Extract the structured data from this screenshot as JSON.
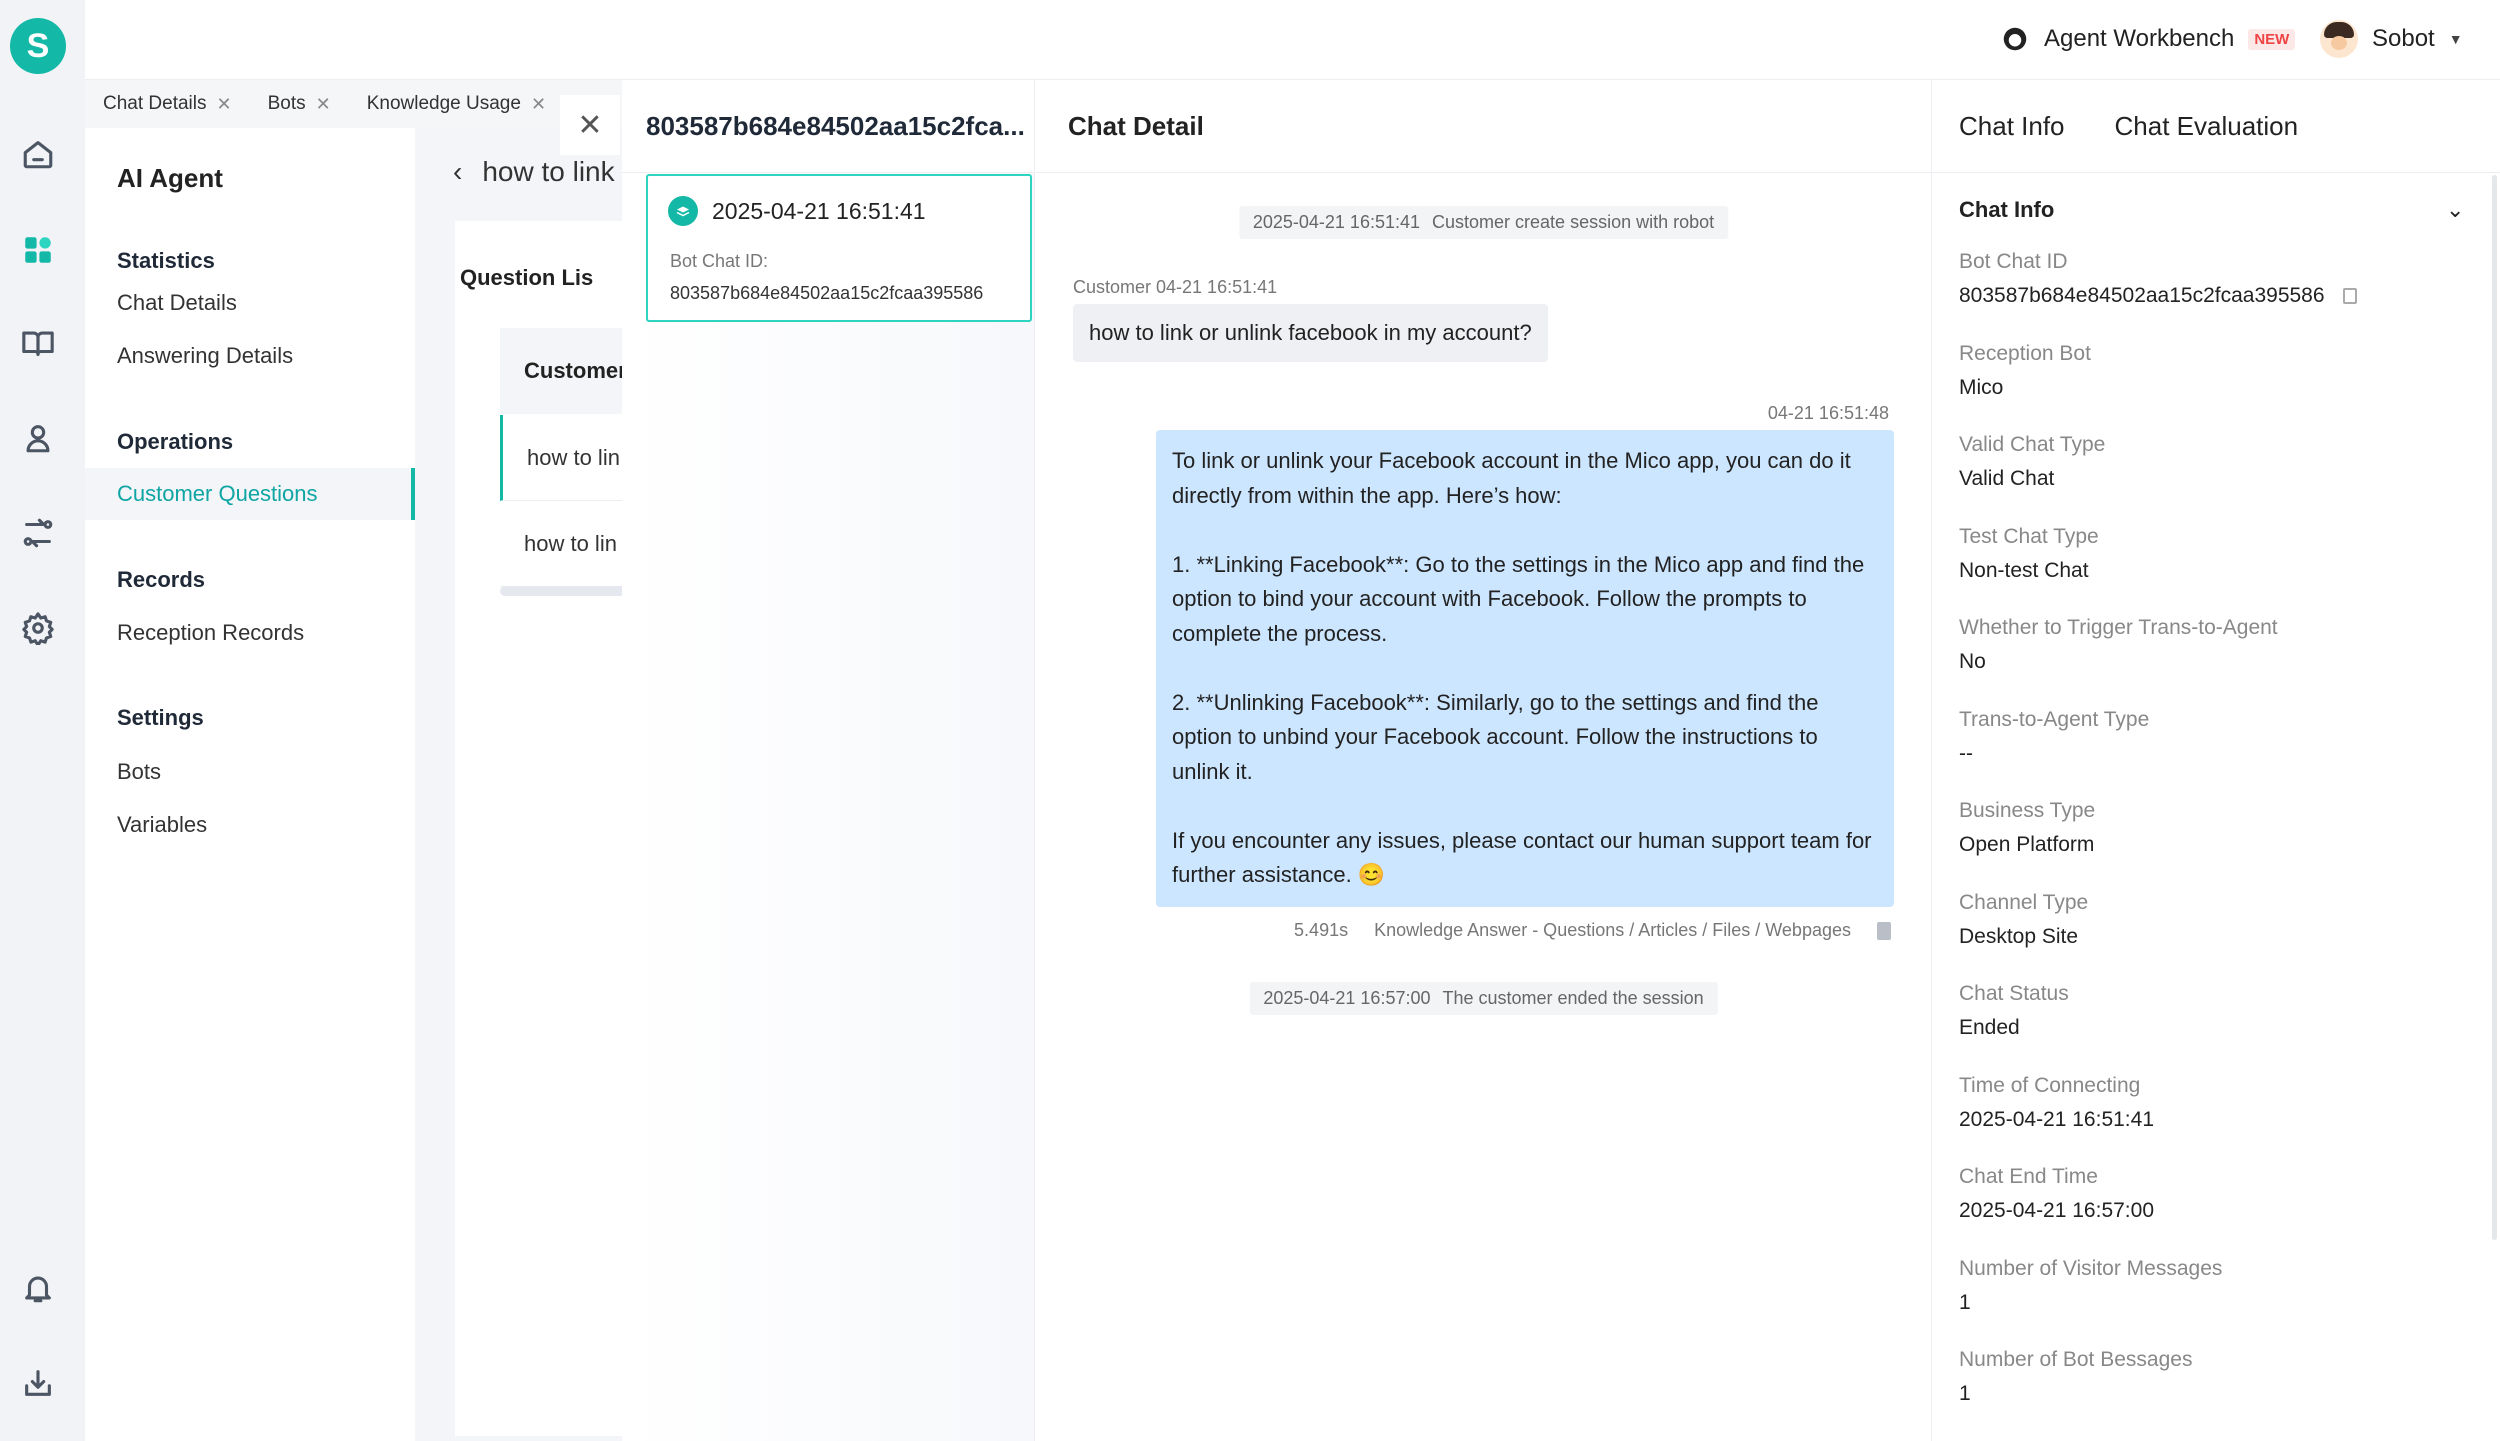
{
  "header": {
    "workbench_label": "Agent Workbench",
    "new_badge": "NEW",
    "user_name": "Sobot"
  },
  "rail": {
    "logo_letter": "S",
    "icons": [
      "home-icon",
      "dashboard-icon",
      "book-icon",
      "agent-icon",
      "routing-icon",
      "settings-icon",
      "bell-icon",
      "download-icon"
    ]
  },
  "tabs": [
    {
      "label": "Chat Details"
    },
    {
      "label": "Bots"
    },
    {
      "label": "Knowledge Usage"
    }
  ],
  "nav": {
    "title": "AI Agent",
    "sections": [
      {
        "label": "Statistics",
        "items": [
          "Chat Details",
          "Answering Details"
        ]
      },
      {
        "label": "Operations",
        "items": [
          "Customer Questions"
        ]
      },
      {
        "label": "Records",
        "items": [
          "Reception Records"
        ]
      },
      {
        "label": "Settings",
        "items": [
          "Bots",
          "Variables"
        ]
      }
    ],
    "active_item": "Customer Questions"
  },
  "background_content": {
    "back_title": "how to link",
    "question_list_title": "Question Lis",
    "table_header": "Customer",
    "rows": [
      "how to lin",
      "how to lin"
    ]
  },
  "sessions": {
    "title": "803587b684e84502aa15c2fca...",
    "card": {
      "time": "2025-04-21 16:51:41",
      "id_label": "Bot Chat ID:",
      "id_value": "803587b684e84502aa15c2fcaa395586"
    }
  },
  "chat": {
    "title": "Chat Detail",
    "sys_start": {
      "time": "2025-04-21 16:51:41",
      "text": "Customer create session with robot"
    },
    "customer_label": "Customer 04-21 16:51:41",
    "customer_message": "how to link or unlink facebook in my account?",
    "bot_time": "04-21 16:51:48",
    "bot_message": "To link or unlink your Facebook account in the Mico app, you can do it directly from within the app. Here’s how:\n\n1. **Linking Facebook**: Go to the settings in the Mico app and find the option to bind your account with Facebook. Follow the prompts to complete the process.\n\n2. **Unlinking Facebook**: Similarly, go to the settings and find the option to unbind your Facebook account. Follow the instructions to unlink it.\n\nIf you encounter any issues, please contact our human support team for further assistance. 😊",
    "response_time": "5.491s",
    "answer_source": "Knowledge Answer - Questions / Articles / Files / Webpages",
    "sys_end": {
      "time": "2025-04-21 16:57:00",
      "text": "The customer ended the session"
    }
  },
  "info": {
    "tab_info": "Chat Info",
    "tab_eval": "Chat Evaluation",
    "section_title": "Chat Info",
    "fields": [
      {
        "key": "Bot Chat ID",
        "value": "803587b684e84502aa15c2fcaa395586"
      },
      {
        "key": "Reception Bot",
        "value": "Mico"
      },
      {
        "key": "Valid Chat Type",
        "value": "Valid Chat"
      },
      {
        "key": "Test Chat Type",
        "value": "Non-test Chat"
      },
      {
        "key": "Whether to Trigger Trans-to-Agent",
        "value": "No"
      },
      {
        "key": "Trans-to-Agent Type",
        "value": "--"
      },
      {
        "key": "Business Type",
        "value": "Open Platform"
      },
      {
        "key": "Channel Type",
        "value": "Desktop Site"
      },
      {
        "key": "Chat Status",
        "value": "Ended"
      },
      {
        "key": "Time of Connecting",
        "value": "2025-04-21 16:51:41"
      },
      {
        "key": "Chat End Time",
        "value": "2025-04-21 16:57:00"
      },
      {
        "key": "Number of Visitor Messages",
        "value": "1"
      },
      {
        "key": "Number of Bot Bessages",
        "value": "1"
      }
    ]
  },
  "colors": {
    "accent": "#14b8a6",
    "bot_bubble": "#cde6ff",
    "customer_bubble": "#eef0f3"
  }
}
